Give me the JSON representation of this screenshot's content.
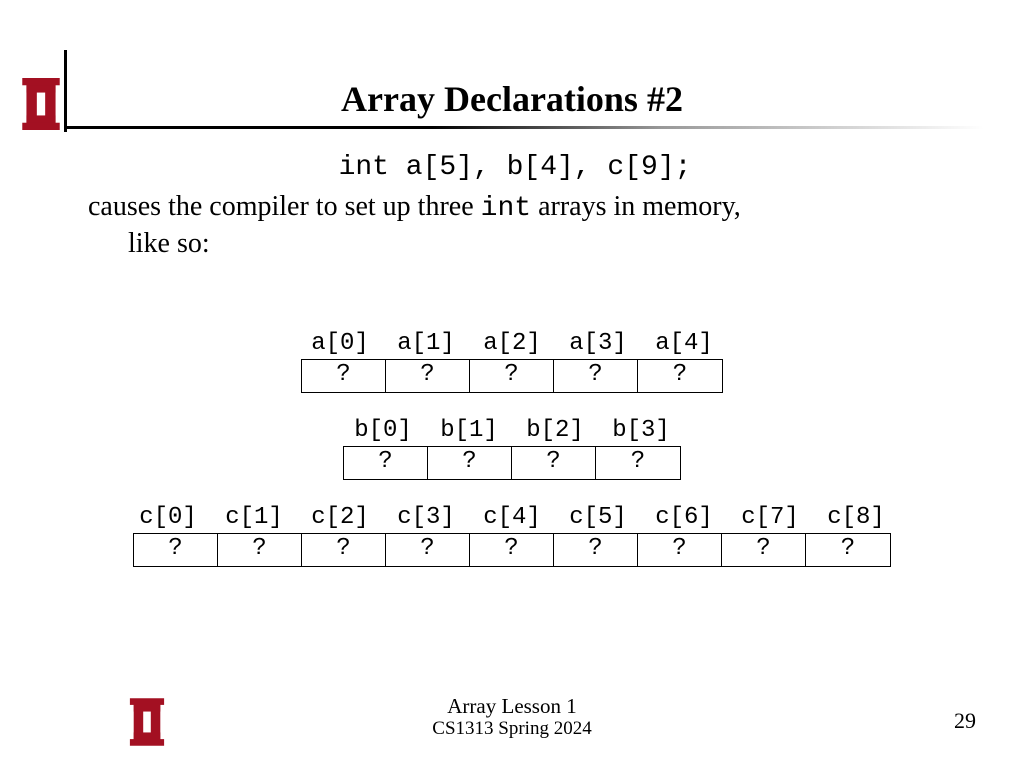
{
  "title": "Array Declarations #2",
  "declaration": "int a[5], b[4], c[9];",
  "explain_before": "causes the compiler to set up three ",
  "explain_code": "int",
  "explain_after": " arrays in memory,",
  "explain_line2": "like so:",
  "arrays": {
    "a": {
      "labels": [
        "a[0]",
        "a[1]",
        "a[2]",
        "a[3]",
        "a[4]"
      ],
      "cells": [
        "?",
        "?",
        "?",
        "?",
        "?"
      ]
    },
    "b": {
      "labels": [
        "b[0]",
        "b[1]",
        "b[2]",
        "b[3]"
      ],
      "cells": [
        "?",
        "?",
        "?",
        "?"
      ]
    },
    "c": {
      "labels": [
        "c[0]",
        "c[1]",
        "c[2]",
        "c[3]",
        "c[4]",
        "c[5]",
        "c[6]",
        "c[7]",
        "c[8]"
      ],
      "cells": [
        "?",
        "?",
        "?",
        "?",
        "?",
        "?",
        "?",
        "?",
        "?"
      ]
    }
  },
  "footer": {
    "lesson": "Array Lesson 1",
    "course": "CS1313 Spring 2024",
    "page": "29"
  },
  "logo_color": "#a31022"
}
